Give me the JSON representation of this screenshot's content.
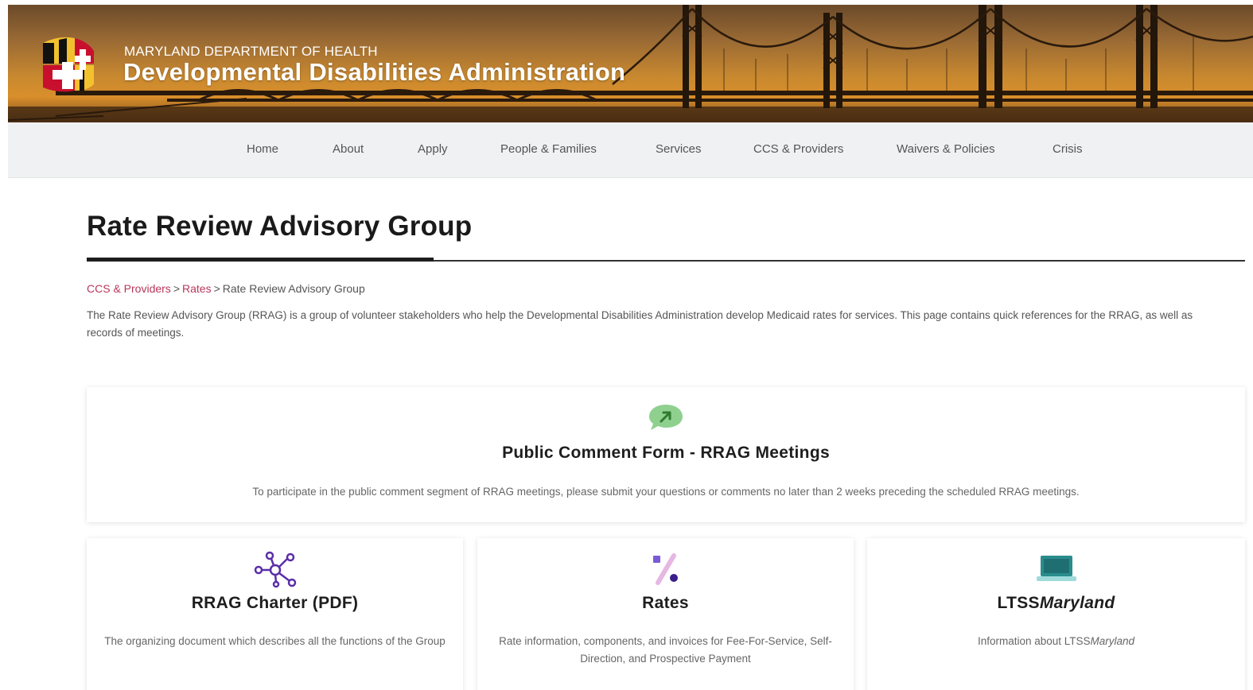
{
  "header": {
    "department": "MARYLAND DEPARTMENT OF HEALTH",
    "title": "Developmental Disabilities Administration"
  },
  "nav": {
    "items": [
      "Home",
      "About",
      "Apply",
      "People & Families",
      "Services",
      "CCS & Providers",
      "Waivers & Policies",
      "Crisis"
    ]
  },
  "page": {
    "title": "Rate Review Advisory Group",
    "breadcrumb": {
      "items": [
        "CCS & Providers",
        "Rates",
        "Rate Review Advisory Group"
      ],
      "separator": ">"
    },
    "intro": "The Rate Review Advisory Group (RRAG) is a group of volunteer stakeholders who help the Developmental Disabilities Administration develop Medicaid rates for services.  This page contains quick references for the RRAG, as well as records of meetings."
  },
  "cards": [
    {
      "title": "Public Comment Form - RRAG Meetings",
      "desc": "To participate in the public comment segment of RRAG meetings, please submit your questions or comments no later than 2 weeks preceding the scheduled RRAG meetings.",
      "icon": "chat-arrow-icon"
    },
    {
      "title": "RRAG Charter (PDF)",
      "desc": "The organizing document which describes all the functions of the Group",
      "icon": "network-icon"
    },
    {
      "title": "Rates",
      "desc": "Rate information, components, and invoices for Fee-For-Service, Self-Direction, and Prospective Payment",
      "icon": "percent-icon"
    },
    {
      "title_prefix": "LTSS",
      "title_italic": "Maryland",
      "desc_prefix": "Information about LTSS",
      "desc_italic": "Maryland",
      "icon": "laptop-icon"
    }
  ],
  "colors": {
    "breadcrumb_link": "#b8365a",
    "icon_green": "#7ac57a",
    "icon_purple": "#5a2ea8",
    "icon_teal": "#2a8c8c",
    "nav_bg": "#f0f1f3"
  }
}
